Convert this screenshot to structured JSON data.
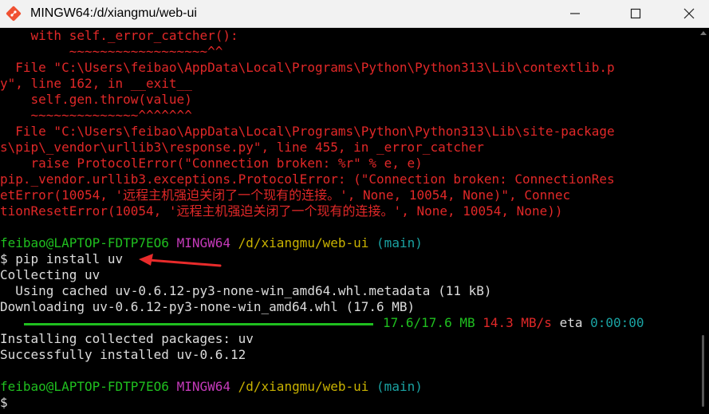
{
  "window": {
    "title": "MINGW64:/d/xiangmu/web-ui",
    "minimize_label": "—",
    "maximize_label": "☐",
    "close_label": "✕"
  },
  "colors": {
    "error_text": "#e12828",
    "user_host": "#1fbf1f",
    "shell_name": "#c53aba",
    "path": "#c9b200",
    "branch": "#1aa3a3",
    "progress": "#1fbf1f",
    "eta": "#1aa3a3",
    "arrow": "#e82b2b"
  },
  "terminal": {
    "traceback": [
      "    with self._error_catcher():",
      "         ~~~~~~~~~~~~~~~~~~^^",
      "  File \"C:\\Users\\feibao\\AppData\\Local\\Programs\\Python\\Python313\\Lib\\contextlib.p",
      "y\", line 162, in __exit__",
      "    self.gen.throw(value)",
      "    ~~~~~~~~~~~~~~^^^^^^^",
      "  File \"C:\\Users\\feibao\\AppData\\Local\\Programs\\Python\\Python313\\Lib\\site-package",
      "s\\pip\\_vendor\\urllib3\\response.py\", line 455, in _error_catcher",
      "    raise ProtocolError(\"Connection broken: %r\" % e, e)",
      "pip._vendor.urllib3.exceptions.ProtocolError: (\"Connection broken: ConnectionRes",
      "etError(10054, '远程主机强迫关闭了一个现有的连接。', None, 10054, None)\", Connec",
      "tionResetError(10054, '远程主机强迫关闭了一个现有的连接。', None, 10054, None))"
    ],
    "prompt1": {
      "user_host": "feibao@LAPTOP-FDTP7EO6",
      "shell": "MINGW64",
      "path": "/d/xiangmu/web-ui",
      "branch": "(main)"
    },
    "command": "$ pip install uv",
    "output": [
      "Collecting uv",
      "  Using cached uv-0.6.12-py3-none-win_amd64.whl.metadata (11 kB)",
      "Downloading uv-0.6.12-py3-none-win_amd64.whl (17.6 MB)"
    ],
    "progress": {
      "fraction": 1.0,
      "size": "17.6/17.6 MB",
      "speed": "14.3 MB/s",
      "eta_label": "eta",
      "eta": "0:00:00"
    },
    "output2": [
      "Installing collected packages: uv",
      "Successfully installed uv-0.6.12"
    ],
    "prompt2": {
      "user_host": "feibao@LAPTOP-FDTP7EO6",
      "shell": "MINGW64",
      "path": "/d/xiangmu/web-ui",
      "branch": "(main)"
    },
    "cursor_prompt": "$"
  }
}
